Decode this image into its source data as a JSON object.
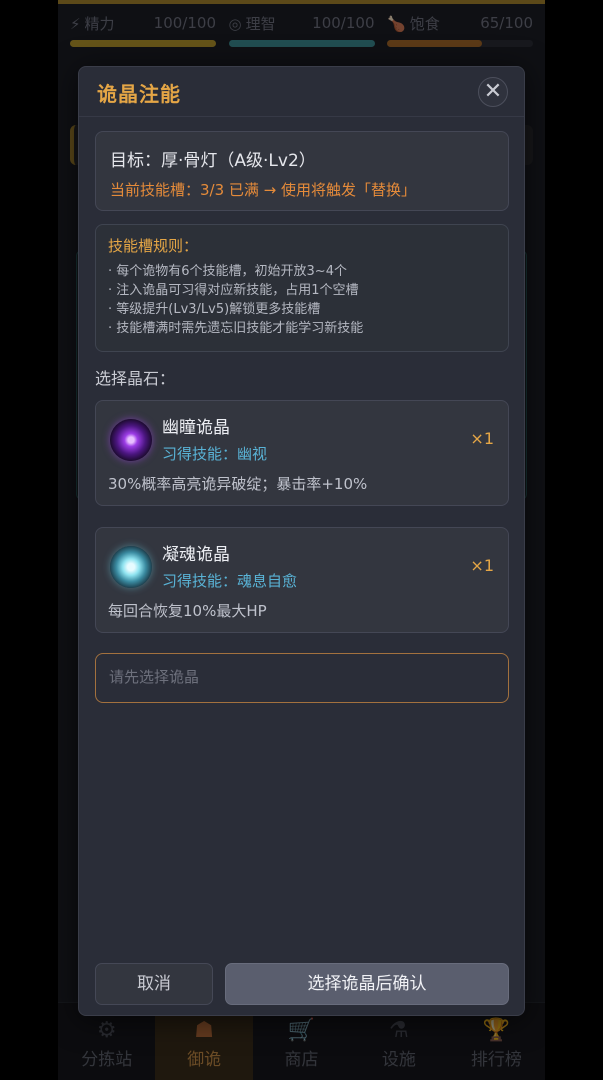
{
  "stats": [
    {
      "icon": "⚡",
      "label": "精力",
      "value": "100/100",
      "level": 1.0,
      "color": "#b89a2f"
    },
    {
      "icon": "◎",
      "label": "理智",
      "value": "100/100",
      "level": 1.0,
      "color": "#3c8f95"
    },
    {
      "icon": "🍗",
      "label": "饱食",
      "value": "65/100",
      "level": 0.65,
      "color": "#a86a2a"
    }
  ],
  "tabs": [
    {
      "icon": "⚙",
      "label": "分拣站",
      "active": false
    },
    {
      "icon": "☗",
      "label": "御诡",
      "active": true
    },
    {
      "icon": "🛒",
      "label": "商店",
      "active": false
    },
    {
      "icon": "⚗",
      "label": "设施",
      "active": false
    },
    {
      "icon": "🏆",
      "label": "排行榜",
      "active": false
    }
  ],
  "modal": {
    "title": "诡晶注能",
    "close": "✕",
    "target_line": "目标：厚·骨灯（A级·Lv2）",
    "target_warn": "当前技能槽：3/3 已满 → 使用将触发「替换」",
    "rules_title": "技能槽规则：",
    "rules": [
      "· 每个诡物有6个技能槽，初始开放3~4个",
      "· 注入诡晶可习得对应新技能，占用1个空槽",
      "· 等级提升(Lv3/Lv5)解锁更多技能槽",
      "· 技能槽满时需先遗忘旧技能才能学习新技能"
    ],
    "section_label": "选择晶石：",
    "crystals": [
      {
        "name": "幽瞳诡晶",
        "skill": "习得技能：幽视",
        "desc": "30%概率高亮诡异破绽；暴击率+10%",
        "count": "×1"
      },
      {
        "name": "凝魂诡晶",
        "skill": "习得技能：魂息自愈",
        "desc": "每回合恢复10%最大HP",
        "count": "×1"
      }
    ],
    "input_placeholder": "请先选择诡晶",
    "cancel_label": "取消",
    "confirm_label": "选择诡晶后确认"
  }
}
